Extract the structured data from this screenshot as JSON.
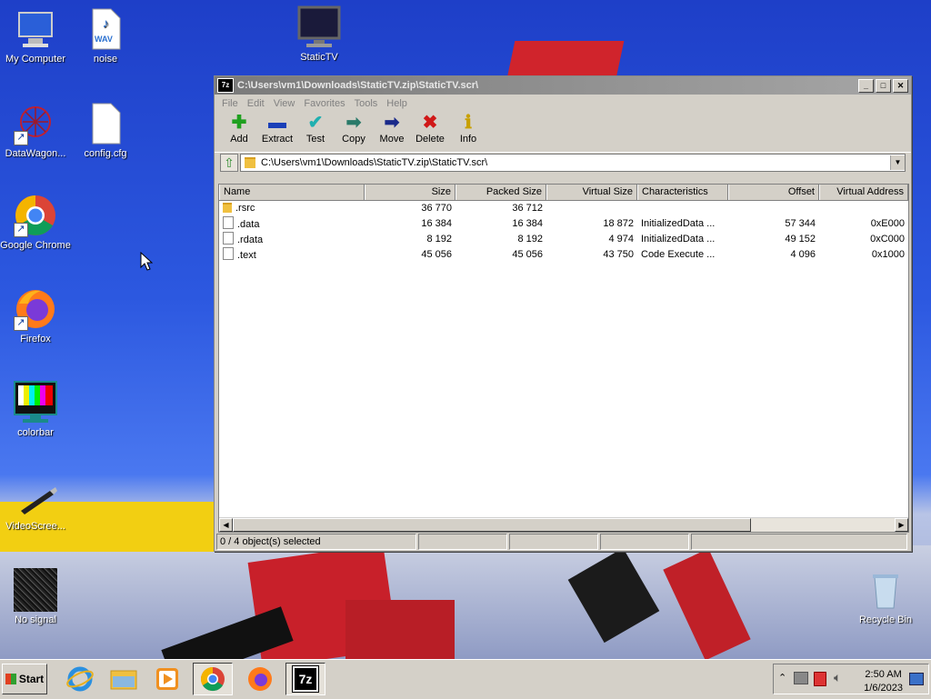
{
  "desktop": {
    "icons": [
      {
        "label": "My Computer"
      },
      {
        "label": "noise"
      },
      {
        "label": "StaticTV"
      },
      {
        "label": "DataWagon..."
      },
      {
        "label": "config.cfg"
      },
      {
        "label": "Google Chrome"
      },
      {
        "label": "Firefox"
      },
      {
        "label": "colorbar"
      },
      {
        "label": "VideoScree..."
      },
      {
        "label": "No signal"
      },
      {
        "label": "Recycle Bin"
      }
    ],
    "wav_label": "WAV"
  },
  "window": {
    "title": "C:\\Users\\vm1\\Downloads\\StaticTV.zip\\StaticTV.scr\\",
    "app_icon_text": "7z",
    "controls": {
      "minimize": "_",
      "maximize": "□",
      "close": "✕"
    },
    "menu": [
      "File",
      "Edit",
      "View",
      "Favorites",
      "Tools",
      "Help"
    ],
    "toolbar": [
      {
        "label": "Add",
        "glyph": "✚",
        "color": "#1fa01f"
      },
      {
        "label": "Extract",
        "glyph": "▬",
        "color": "#1a3fb8"
      },
      {
        "label": "Test",
        "glyph": "✔",
        "color": "#20b0b0"
      },
      {
        "label": "Copy",
        "glyph": "➡",
        "color": "#2a7a6a"
      },
      {
        "label": "Move",
        "glyph": "➡",
        "color": "#1a2a8a"
      },
      {
        "label": "Delete",
        "glyph": "✖",
        "color": "#d01818"
      },
      {
        "label": "Info",
        "glyph": "ℹ",
        "color": "#c8a000"
      }
    ],
    "address": "C:\\Users\\vm1\\Downloads\\StaticTV.zip\\StaticTV.scr\\",
    "columns": [
      "Name",
      "Size",
      "Packed Size",
      "Virtual Size",
      "Characteristics",
      "Offset",
      "Virtual Address"
    ],
    "rows": [
      {
        "type": "folder",
        "name": ".rsrc",
        "size": "36 770",
        "packed": "36 712",
        "vsize": "",
        "chars": "",
        "offset": "",
        "vaddr": ""
      },
      {
        "type": "file",
        "name": ".data",
        "size": "16 384",
        "packed": "16 384",
        "vsize": "18 872",
        "chars": "InitializedData ...",
        "offset": "57 344",
        "vaddr": "0xE000"
      },
      {
        "type": "file",
        "name": ".rdata",
        "size": "8 192",
        "packed": "8 192",
        "vsize": "4 974",
        "chars": "InitializedData ...",
        "offset": "49 152",
        "vaddr": "0xC000"
      },
      {
        "type": "file",
        "name": ".text",
        "size": "45 056",
        "packed": "45 056",
        "vsize": "43 750",
        "chars": "Code Execute ...",
        "offset": "4 096",
        "vaddr": "0x1000"
      }
    ],
    "status": "0 / 4 object(s) selected"
  },
  "taskbar": {
    "start_label": "Start",
    "apps": [
      "internet-explorer",
      "file-explorer",
      "media-player",
      "chrome",
      "firefox",
      "7zip"
    ],
    "sevenzip_text": "7z",
    "time": "2:50 AM",
    "date": "1/6/2023"
  }
}
